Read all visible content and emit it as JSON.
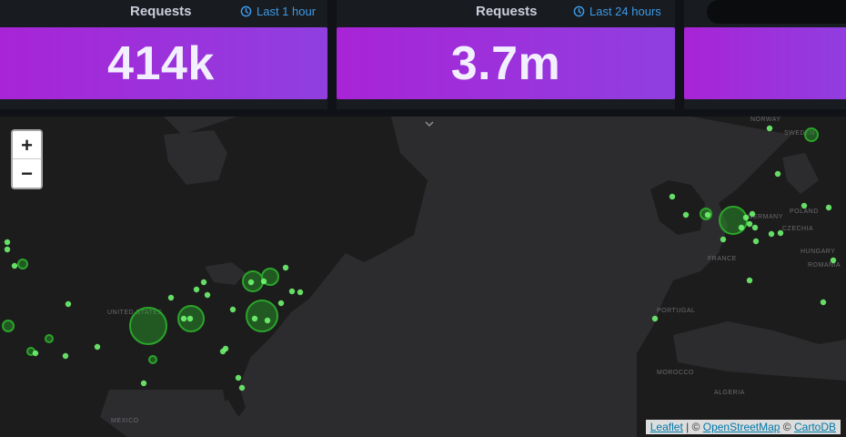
{
  "panels": [
    {
      "title": "Requests",
      "time_range": "Last 1 hour",
      "value": "414k"
    },
    {
      "title": "Requests",
      "time_range": "Last 24 hours",
      "value": "3.7m"
    }
  ],
  "map": {
    "zoom_in_label": "+",
    "zoom_out_label": "−",
    "attribution": {
      "leaflet": "Leaflet",
      "sep1": " | © ",
      "osm": "OpenStreetMap",
      "sep2": " © ",
      "carto": "CartoDB"
    },
    "labels": {
      "united_states": "UNITED STATES",
      "mexico": "MEXICO",
      "france": "FRANCE",
      "portugal": "PORTUGAL",
      "morocco": "MOROCCO",
      "algeria": "ALGERIA",
      "norway": "NORWAY",
      "sweden": "SWEDEN",
      "germany": "GERMANY",
      "poland": "POLAND",
      "czechia": "CZECHIA",
      "hungary": "HUNGARY",
      "romania": "ROMANIA"
    }
  },
  "colors": {
    "stat_gradient_start": "#a824d6",
    "stat_gradient_end": "#8f3fe0",
    "marker_fill": "#2aa52a",
    "marker_dot": "#73ff73",
    "accent_link": "#3d9ae8"
  }
}
